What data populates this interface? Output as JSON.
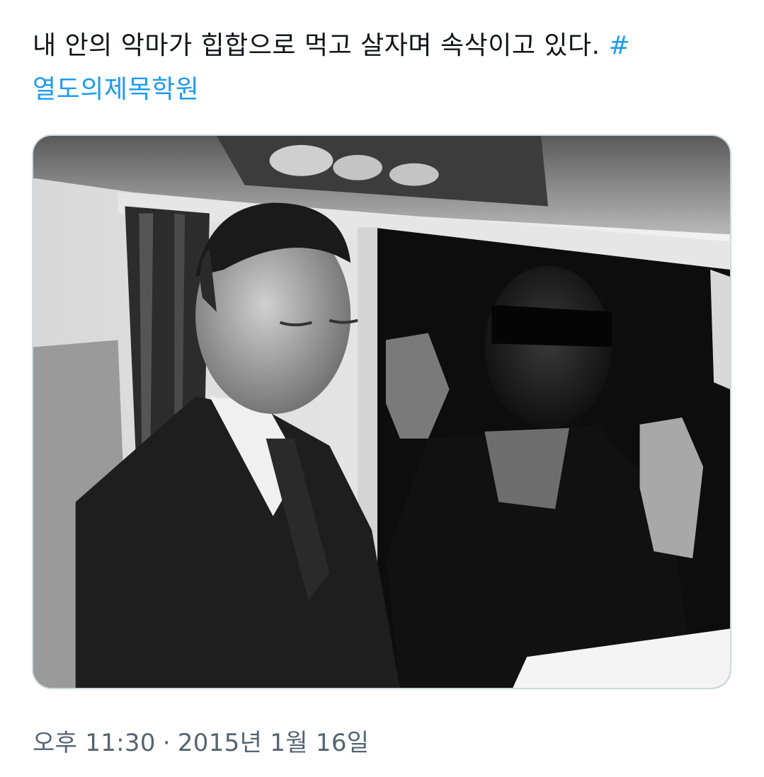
{
  "tweet": {
    "text": "내 안의 악마가 힙합으로 먹고 살자며 속삭이고 있다. ",
    "hashtag": "#열도의제목학원"
  },
  "media": {
    "description_icon": "photo-image"
  },
  "meta": {
    "time": "오후 11:30",
    "separator": "·",
    "date": "2015년 1월 16일"
  }
}
